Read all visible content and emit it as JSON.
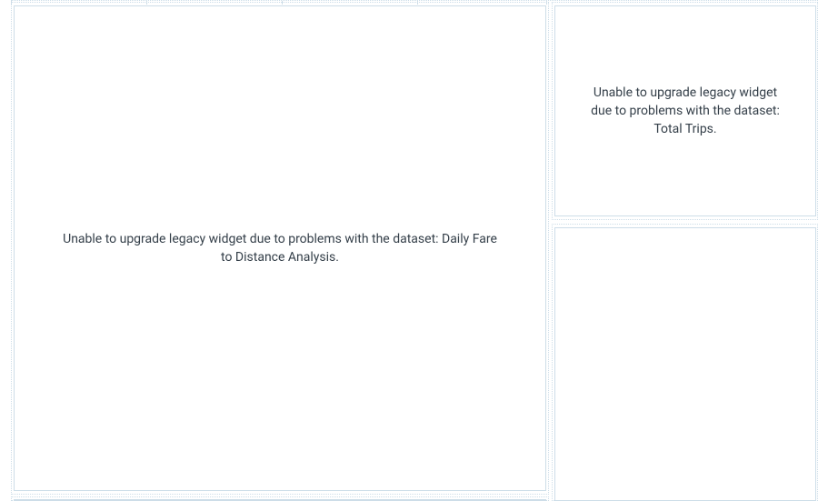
{
  "widgets": {
    "main_left": {
      "error_message": "Unable to upgrade legacy widget due to problems with the dataset: Daily Fare to Distance Analysis."
    },
    "top_right": {
      "error_message": "Unable to upgrade legacy widget due to problems with the dataset: Total Trips."
    },
    "bottom_right": {
      "error_message": ""
    },
    "bottom_left_partial": {
      "error_message": ""
    }
  }
}
